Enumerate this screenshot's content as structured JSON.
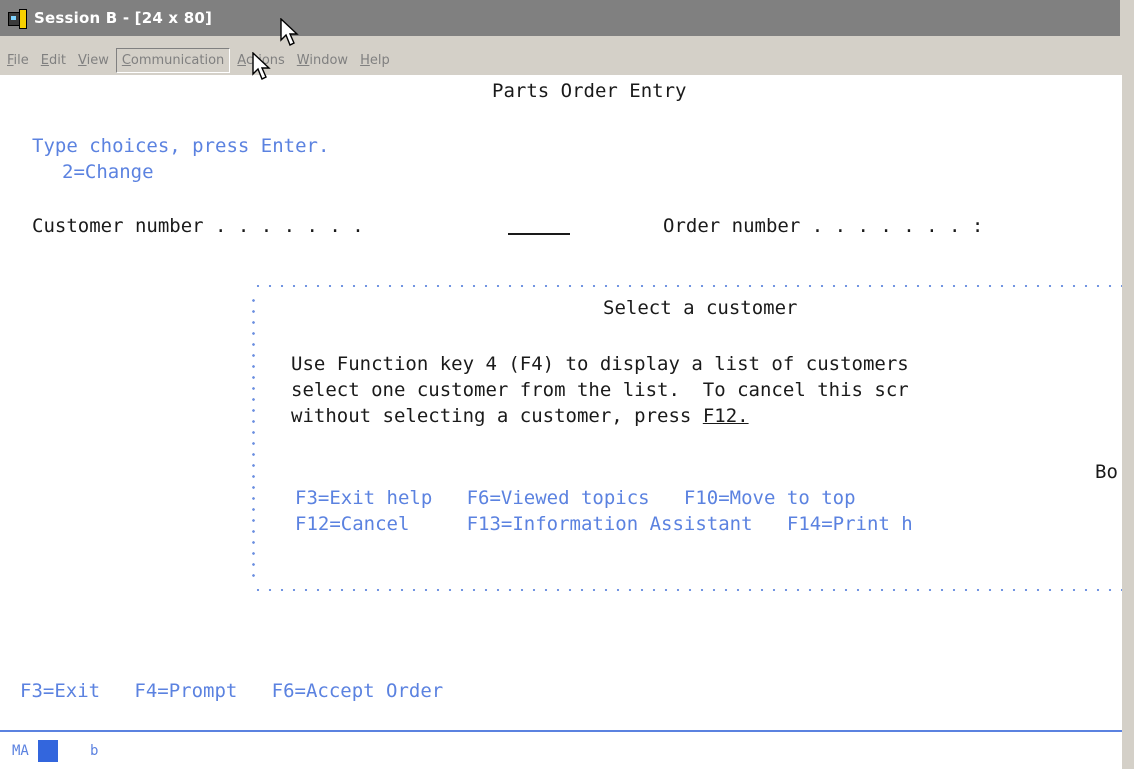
{
  "window": {
    "title": "Session B - [24 x 80]"
  },
  "menu": [
    {
      "label": "File",
      "ul": "F",
      "rest": "ile"
    },
    {
      "label": "Edit",
      "ul": "E",
      "rest": "dit"
    },
    {
      "label": "View",
      "ul": "V",
      "rest": "iew"
    },
    {
      "label": "Communication",
      "ul": "C",
      "rest": "ommunication",
      "active": true
    },
    {
      "label": "Actions",
      "ul": "A",
      "rest": "ctions"
    },
    {
      "label": "Window",
      "ul": "W",
      "rest": "indow"
    },
    {
      "label": "Help",
      "ul": "H",
      "rest": "elp"
    }
  ],
  "screen": {
    "title": "Parts Order Entry",
    "instruction": "Type choices, press Enter.",
    "option": "2=Change",
    "customer_label": "Customer number . . . . . . .",
    "order_label": "Order number . . . . . . . :",
    "help": {
      "title": "Select a customer",
      "line1": "Use Function key 4 (F4) to display a list of customers",
      "line2": "select one customer from the list.  To cancel this scr",
      "line3_prefix": "without selecting a customer, press ",
      "line3_link": "F12.",
      "bottom_marker": "Bo",
      "keys_row1": "F3=Exit help   F6=Viewed topics   F10=Move to top",
      "keys_row2": "F12=Cancel     F13=Information Assistant   F14=Print h"
    },
    "function_keys": "F3=Exit   F4=Prompt   F6=Accept Order"
  },
  "status": {
    "mode": "MA",
    "indicator": "b"
  },
  "colors": {
    "text": "#1a1a1a",
    "blue": "#5b82e0",
    "titlebar": "#808080",
    "chrome": "#d4d0c8"
  }
}
